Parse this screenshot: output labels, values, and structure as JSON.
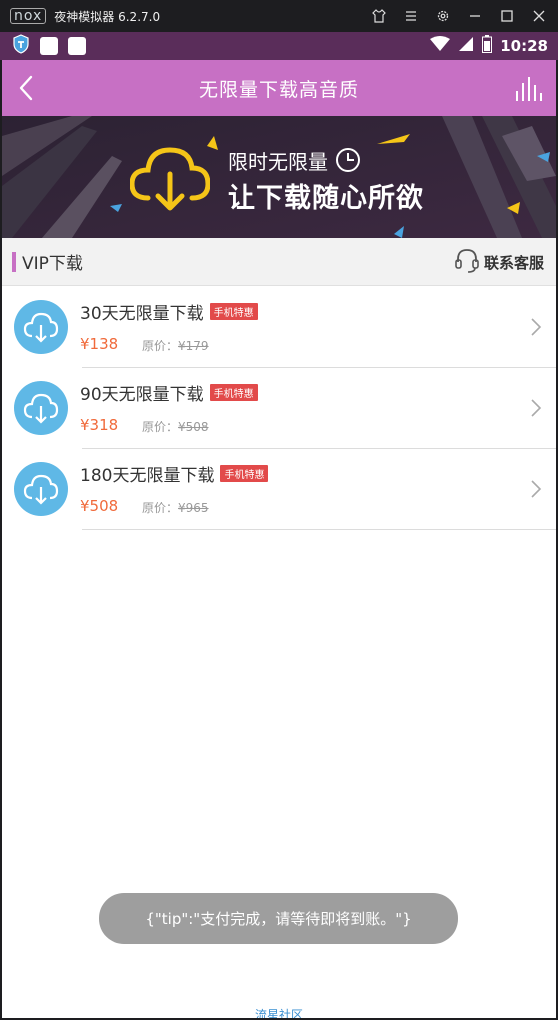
{
  "emulator": {
    "logo": "nox",
    "title": "夜神模拟器 6.2.7.0",
    "controls": [
      "shirt-icon",
      "menu-icon",
      "gear-icon",
      "minimize-icon",
      "maximize-icon",
      "close-icon"
    ]
  },
  "status_bar": {
    "time": "10:28",
    "icons": [
      "shield-icon",
      "notification-square-icon",
      "notification-square-icon",
      "wifi-icon",
      "signal-icon",
      "battery-icon"
    ]
  },
  "header": {
    "title": "无限量下载高音质",
    "back_icon": "chevron-left-icon",
    "right_icon": "equalizer-icon",
    "bg_color": "#c770c4"
  },
  "banner": {
    "line1": "限时无限量",
    "line2": "让下载随心所欲",
    "accent_color": "#f5c518"
  },
  "section": {
    "title": "VIP下载",
    "contact_label": "联系客服",
    "contact_icon": "headset-icon"
  },
  "products": [
    {
      "name": "30天无限量下载",
      "tag": "手机特惠",
      "price": "¥138",
      "orig_label": "原价：",
      "orig_price": "¥179"
    },
    {
      "name": "90天无限量下载",
      "tag": "手机特惠",
      "price": "¥318",
      "orig_label": "原价：",
      "orig_price": "¥508"
    },
    {
      "name": "180天无限量下载",
      "tag": "手机特惠",
      "price": "¥508",
      "orig_label": "原价：",
      "orig_price": "¥965"
    }
  ],
  "toast": {
    "text": "{\"tip\":\"支付完成，请等待即将到账。\"}"
  },
  "footer": {
    "link": "流星社区"
  },
  "colors": {
    "price": "#f06a3b",
    "tag": "#e24a4a",
    "icon_bg": "#5fb8e6"
  }
}
